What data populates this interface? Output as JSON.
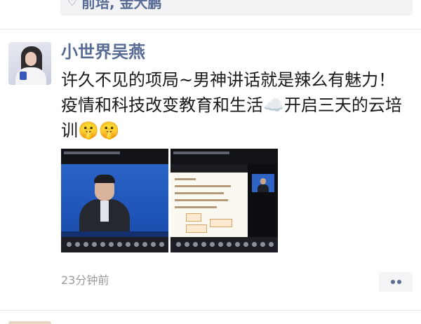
{
  "previous_post": {
    "likes_text": "前培, 金大鹏"
  },
  "post": {
    "username": "小世界吴燕",
    "text": "许久不见的项局~男神讲话就是辣么有魅力！疫情和科技改变教育和生活☁️开启三天的云培训🤫🤫",
    "timestamp": "23分钟前",
    "images": [
      {
        "description_icon": "video-conference-speaker"
      },
      {
        "description_icon": "video-conference-slides"
      }
    ]
  },
  "colors": {
    "link_blue": "#576b95",
    "text_dark": "#1a1a1a",
    "timestamp_gray": "#9a9a9a",
    "panel_bg": "#f4f4f6"
  },
  "icons": {
    "heart": "heart-icon",
    "more": "more-dots-icon"
  }
}
